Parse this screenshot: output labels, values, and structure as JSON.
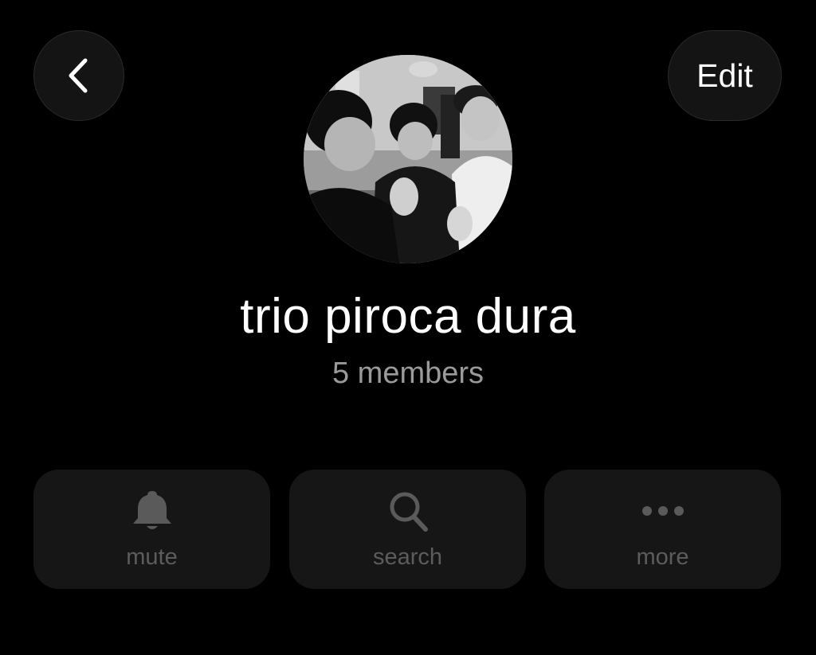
{
  "header": {
    "back_icon": "chevron-left-icon",
    "edit_label": "Edit"
  },
  "group": {
    "title": "trio piroca dura",
    "member_count": "5 members"
  },
  "actions": [
    {
      "label": "mute",
      "icon": "bell-icon"
    },
    {
      "label": "search",
      "icon": "search-icon"
    },
    {
      "label": "more",
      "icon": "more-dots-icon"
    }
  ],
  "colors": {
    "background": "#000000",
    "button_bg": "#141414",
    "card_bg": "#161616",
    "subtitle": "#9a9a9a",
    "muted_icon": "#5a5a5a"
  }
}
